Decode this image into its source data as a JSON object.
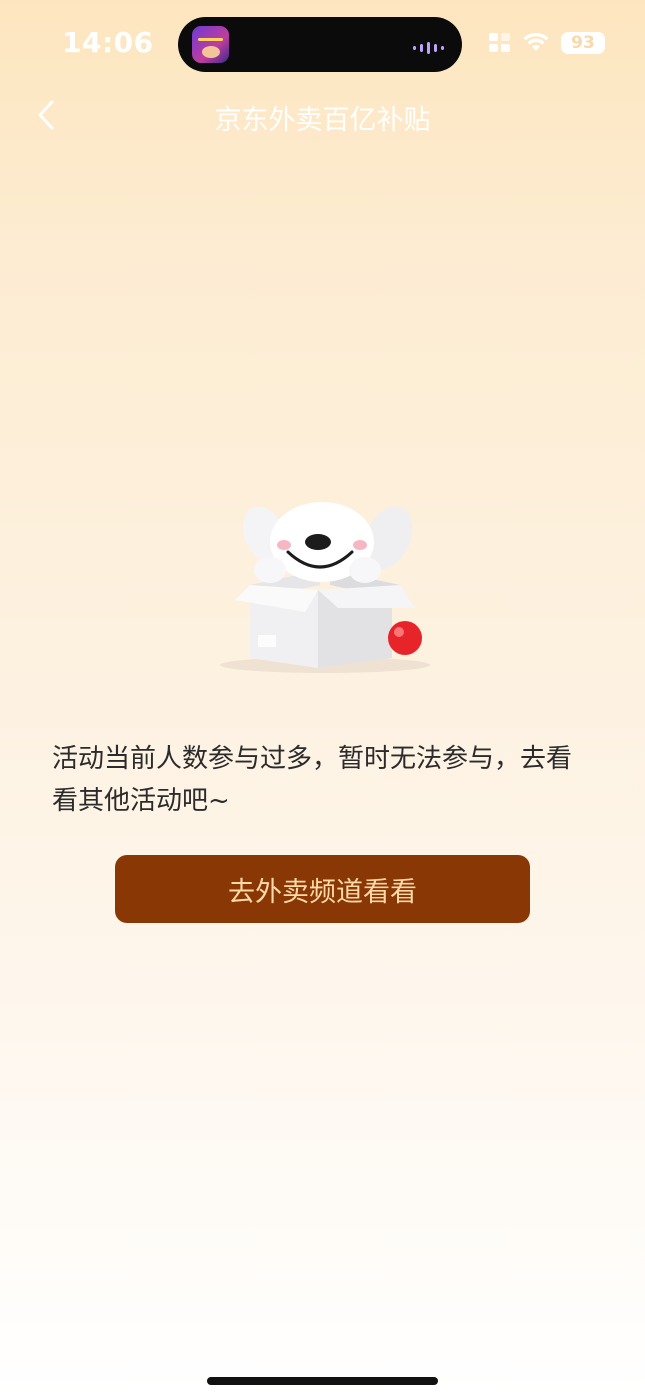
{
  "status_bar": {
    "time": "14:06",
    "battery": "93",
    "icons": [
      "grid-icon",
      "wifi-icon",
      "battery-icon"
    ]
  },
  "nav": {
    "title": "京东外卖百亿补贴",
    "back_icon": "chevron-left-icon"
  },
  "content": {
    "illustration": "joy-dog-in-box",
    "message": "活动当前人数参与过多，暂时无法参与，去看看其他活动吧~",
    "button_label": "去外卖频道看看"
  },
  "colors": {
    "button_bg": "#8a3706",
    "button_text": "#ffd9a8",
    "background_top": "#fde6bf",
    "background_bottom": "#ffffff"
  }
}
